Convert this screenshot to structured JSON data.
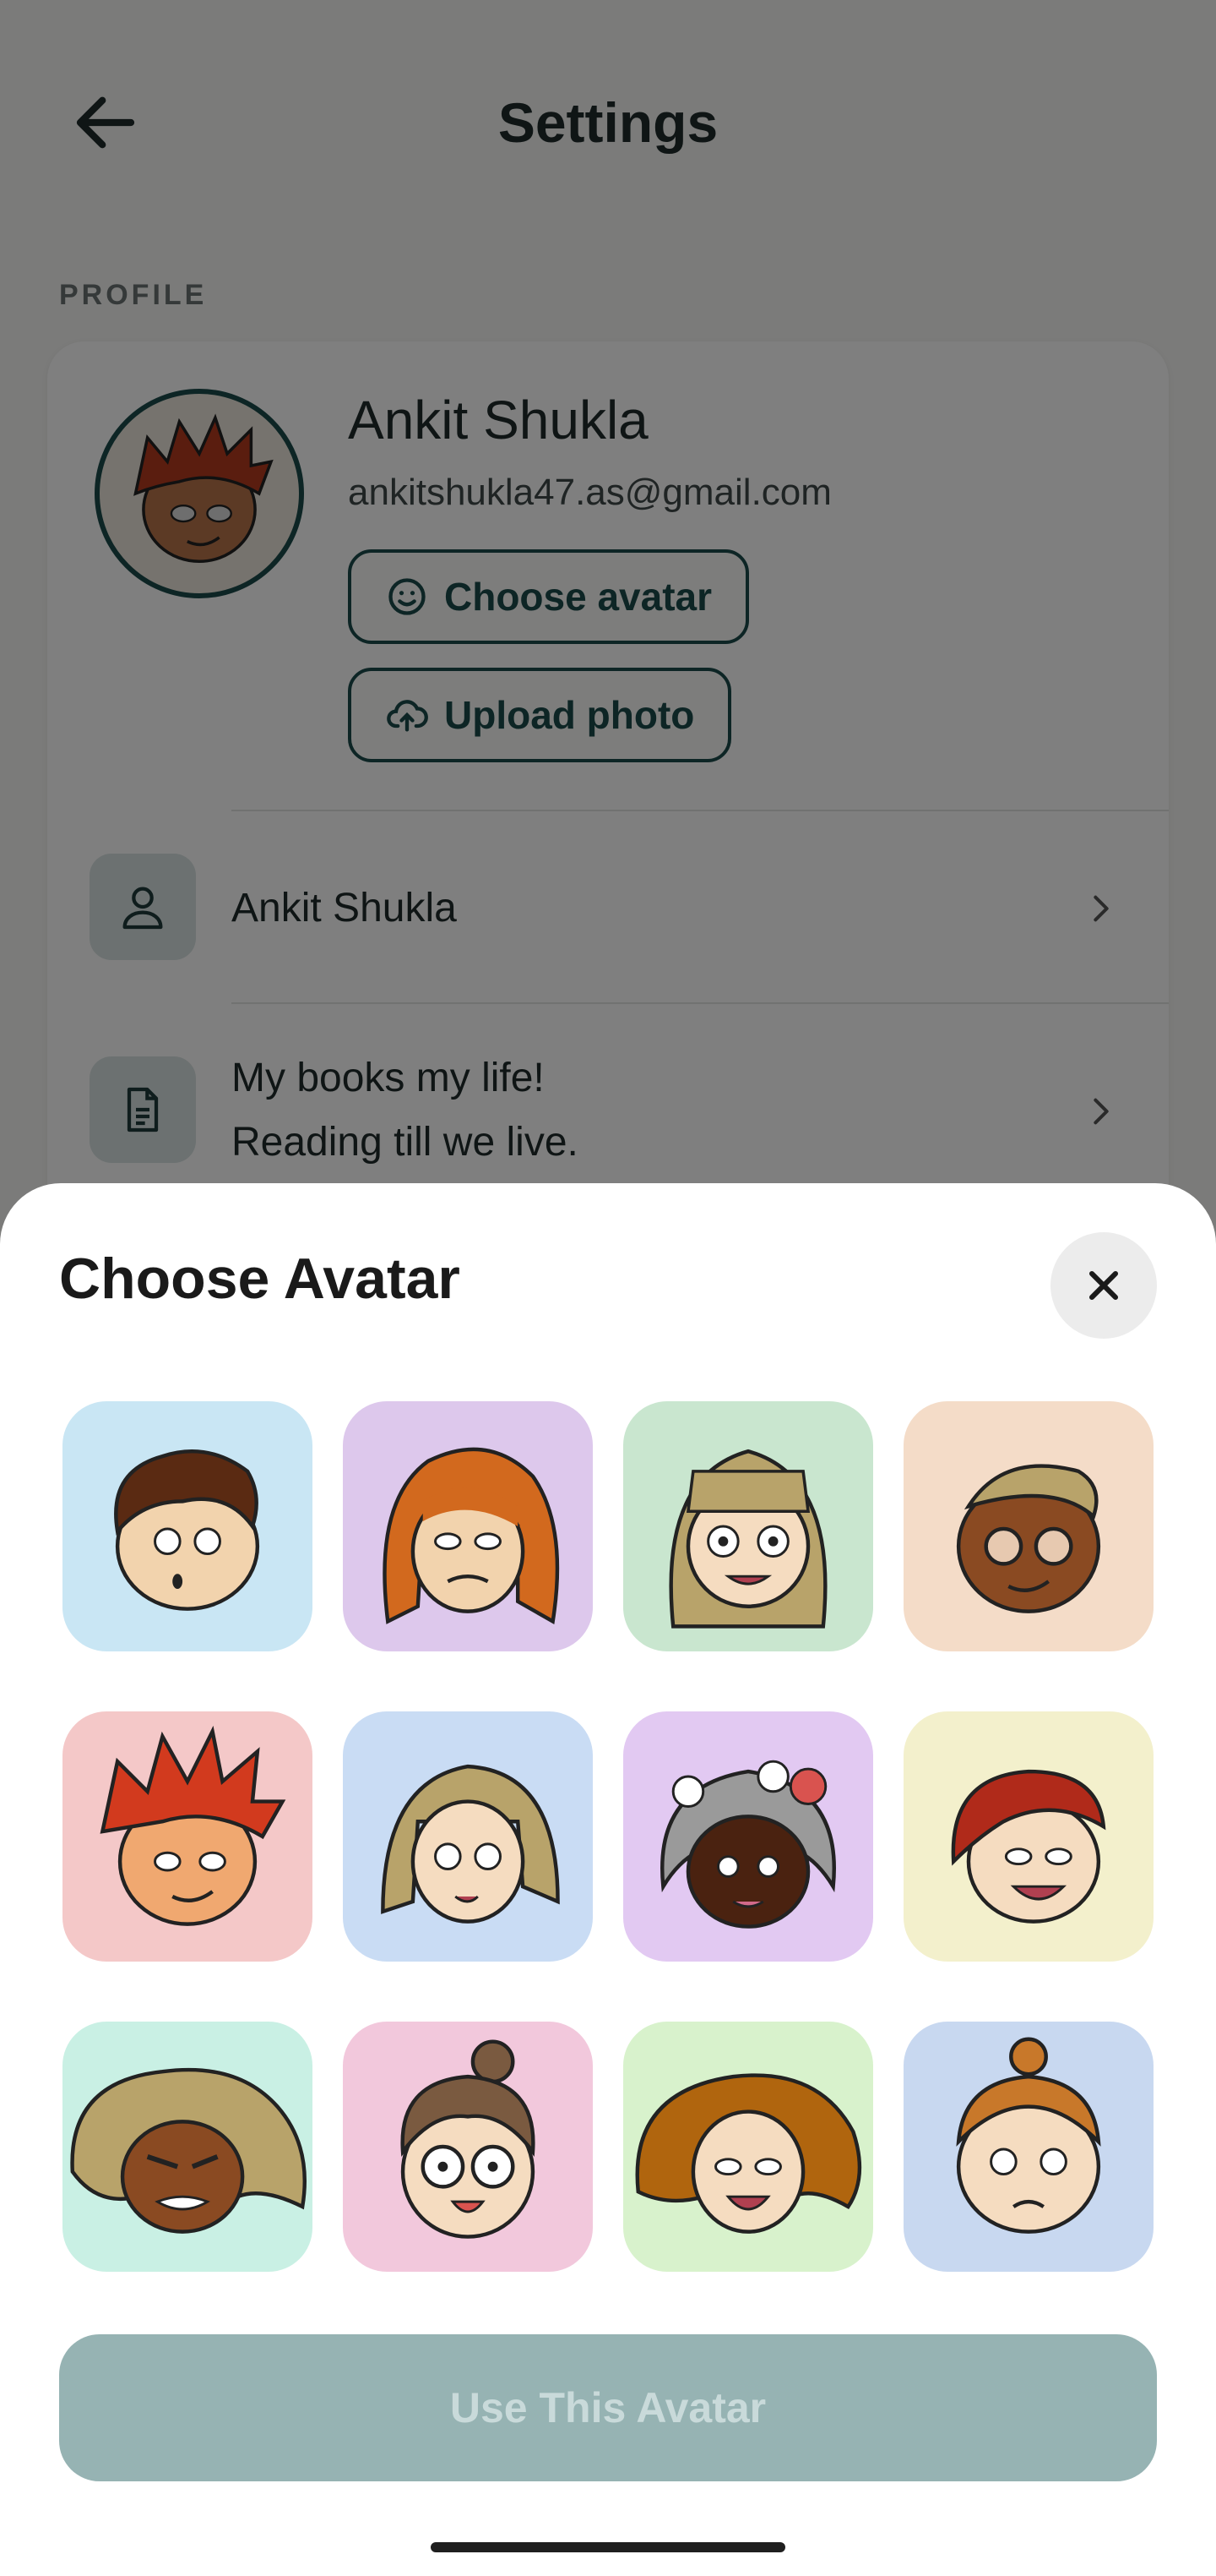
{
  "header": {
    "title": "Settings"
  },
  "profile": {
    "section_label": "PROFILE",
    "name": "Ankit Shukla",
    "email": "ankitshukla47.as@gmail.com",
    "choose_avatar_label": "Choose avatar",
    "upload_photo_label": "Upload photo"
  },
  "rows": [
    {
      "icon": "person-icon",
      "text": "Ankit Shukla"
    },
    {
      "icon": "document-icon",
      "line1": "My books my life!",
      "line2": "Reading till we live."
    }
  ],
  "sheet": {
    "title": "Choose Avatar",
    "use_button_label": "Use This Avatar",
    "avatars": [
      {
        "bg": "#c9e6f4"
      },
      {
        "bg": "#ddc8ec"
      },
      {
        "bg": "#c9e6cf"
      },
      {
        "bg": "#f4dcc8"
      },
      {
        "bg": "#f4c8c8"
      },
      {
        "bg": "#c9dcf4"
      },
      {
        "bg": "#e2c9f2"
      },
      {
        "bg": "#f3f0cc"
      },
      {
        "bg": "#c9f0e4"
      },
      {
        "bg": "#f2c8dc"
      },
      {
        "bg": "#d8f2cc"
      },
      {
        "bg": "#c8d8f0"
      }
    ]
  },
  "colors": {
    "accent": "#1b4b4b",
    "disabled_button": "#96b3b3"
  }
}
